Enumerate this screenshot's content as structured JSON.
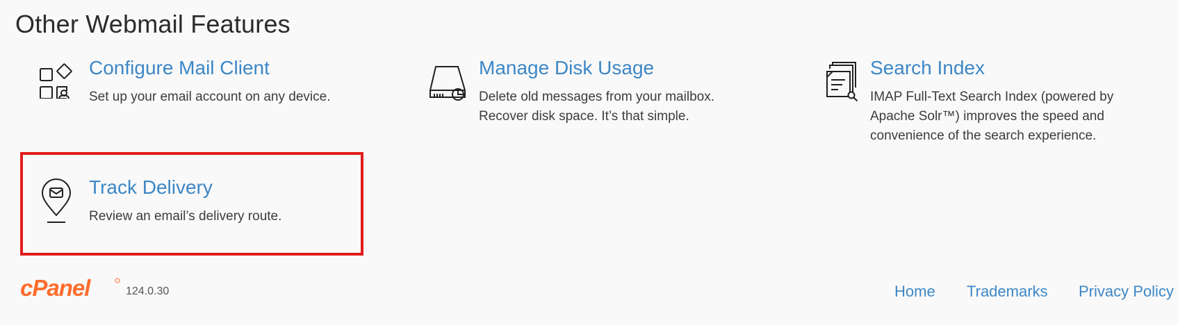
{
  "section": {
    "title": "Other Webmail Features"
  },
  "features": [
    {
      "title": "Configure Mail Client",
      "description": "Set up your email account on any device.",
      "icon": "apps-configure-icon"
    },
    {
      "title": "Manage Disk Usage",
      "description": "Delete old messages from your mailbox. Recover disk space. It’s that simple.",
      "icon": "disk-usage-icon"
    },
    {
      "title": "Search Index",
      "description": "IMAP Full-Text Search Index (powered by Apache Solr™) improves the speed and convenience of the search experience.",
      "icon": "search-index-icon"
    },
    {
      "title": "Track Delivery",
      "description": "Review an email’s delivery route.",
      "icon": "location-mail-icon"
    }
  ],
  "footer": {
    "logo": "cPanel",
    "version": "124.0.30",
    "links": [
      "Home",
      "Trademarks",
      "Privacy Policy"
    ]
  },
  "colors": {
    "link": "#3d87c6",
    "text": "#3c3c3c",
    "highlight": "#e21c1c",
    "brand": "#ff6c2c",
    "background": "#f9f9f9"
  }
}
